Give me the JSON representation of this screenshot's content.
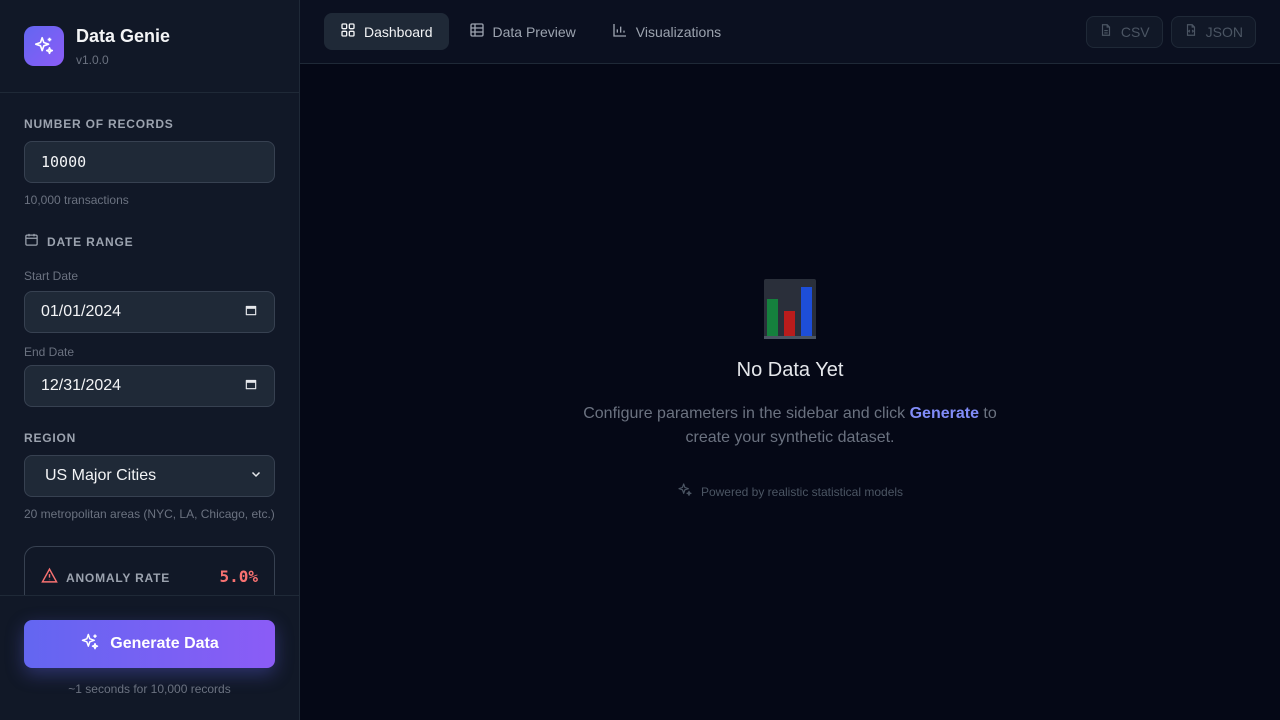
{
  "app": {
    "name": "Data Genie",
    "version": "v1.0.0"
  },
  "sidebar": {
    "records": {
      "label": "NUMBER OF RECORDS",
      "value": "10000",
      "hint": "10,000 transactions"
    },
    "date_range": {
      "label": "DATE RANGE",
      "start_label": "Start Date",
      "start_value": "01/01/2024",
      "end_label": "End Date",
      "end_value": "12/31/2024"
    },
    "region": {
      "label": "REGION",
      "selected": "US Major Cities",
      "hint": "20 metropolitan areas (NYC, LA, Chicago, etc.)"
    },
    "anomaly": {
      "label": "ANOMALY RATE",
      "value": "5.0%"
    },
    "generate": {
      "label": "Generate Data",
      "sub": "~1 seconds for 10,000 records"
    }
  },
  "tabs": [
    {
      "label": "Dashboard",
      "icon": "grid-icon",
      "active": true
    },
    {
      "label": "Data Preview",
      "icon": "table-icon",
      "active": false
    },
    {
      "label": "Visualizations",
      "icon": "bar-chart-icon",
      "active": false
    }
  ],
  "exports": {
    "csv": "CSV",
    "json": "JSON"
  },
  "empty_state": {
    "title": "No Data Yet",
    "text_before": "Configure parameters in the sidebar and click ",
    "text_accent": "Generate",
    "text_after": " to create your synthetic dataset.",
    "powered": "Powered by realistic statistical models"
  },
  "colors": {
    "accent": "#6366f1",
    "accent2": "#8b5cf6",
    "danger": "#f87171",
    "background": "#050816"
  }
}
